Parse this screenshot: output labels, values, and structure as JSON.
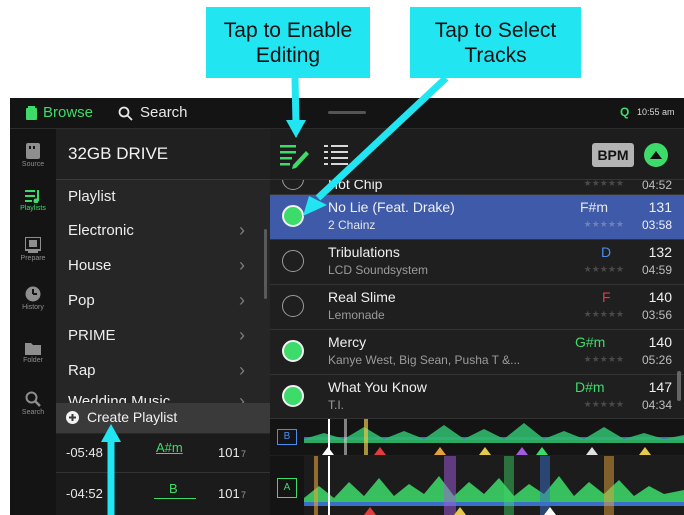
{
  "callouts": {
    "edit": "Tap to Enable Editing",
    "select": "Tap to Select Tracks"
  },
  "topbar": {
    "browse_label": "Browse",
    "search_label": "Search",
    "clock": "10:55 am",
    "status_letter": "Q"
  },
  "rail": [
    {
      "label": "Source",
      "icon": "sd-card-icon",
      "active": false
    },
    {
      "label": "Playlists",
      "icon": "playlist-icon",
      "active": true
    },
    {
      "label": "Prepare",
      "icon": "prepare-icon",
      "active": false
    },
    {
      "label": "History",
      "icon": "history-icon",
      "active": false
    },
    {
      "label": "Folder",
      "icon": "folder-icon",
      "active": false
    },
    {
      "label": "Search",
      "icon": "search-icon",
      "active": false
    }
  ],
  "left": {
    "drive": "32GB DRIVE",
    "items": [
      {
        "label": "Playlist",
        "chevron": false
      },
      {
        "label": "Electronic",
        "chevron": true
      },
      {
        "label": "House",
        "chevron": true
      },
      {
        "label": "Pop",
        "chevron": true
      },
      {
        "label": "PRIME",
        "chevron": true
      },
      {
        "label": "Rap",
        "chevron": true
      },
      {
        "label": "Wedding Music",
        "chevron": true
      }
    ],
    "create": "Create Playlist",
    "decks": [
      {
        "time": "-05:48",
        "sub": "3",
        "key": "A#m",
        "bpm": "101",
        "bpm_sub": "7"
      },
      {
        "time": "-04:52",
        "sub": "2",
        "key": "B",
        "bpm": "101",
        "bpm_sub": "7"
      }
    ]
  },
  "right": {
    "sort_button": "BPM",
    "partial": {
      "title": "Hot Chip",
      "time": "04:52"
    },
    "tracks": [
      {
        "title": "No Lie (Feat. Drake)",
        "artist": "2 Chainz",
        "key": "F#m",
        "key_color": "#e8e8e8",
        "bpm": "131",
        "time": "03:58",
        "selected": true,
        "checked": true
      },
      {
        "title": "Tribulations",
        "artist": "LCD Soundsystem",
        "key": "D",
        "key_color": "#4a8df0",
        "bpm": "132",
        "time": "04:59",
        "selected": false,
        "checked": false
      },
      {
        "title": "Real Slime",
        "artist": "Lemonade",
        "key": "F",
        "key_color": "#e03c3c",
        "bpm": "140",
        "time": "03:56",
        "selected": false,
        "checked": false
      },
      {
        "title": "Mercy",
        "artist": "Kanye West, Big Sean, Pusha T &...",
        "key": "G#m",
        "key_color": "#3ddc6a",
        "bpm": "140",
        "time": "05:26",
        "selected": false,
        "checked": true
      },
      {
        "title": "What You Know",
        "artist": "T.I.",
        "key": "D#m",
        "key_color": "#3ddc6a",
        "bpm": "147",
        "time": "04:34",
        "selected": false,
        "checked": true
      }
    ],
    "deck_b": "B",
    "deck_a": "A"
  },
  "colors": {
    "accent_green": "#3ddc6a",
    "selected_row": "#3e5aa8",
    "callout": "#22e5f2"
  }
}
